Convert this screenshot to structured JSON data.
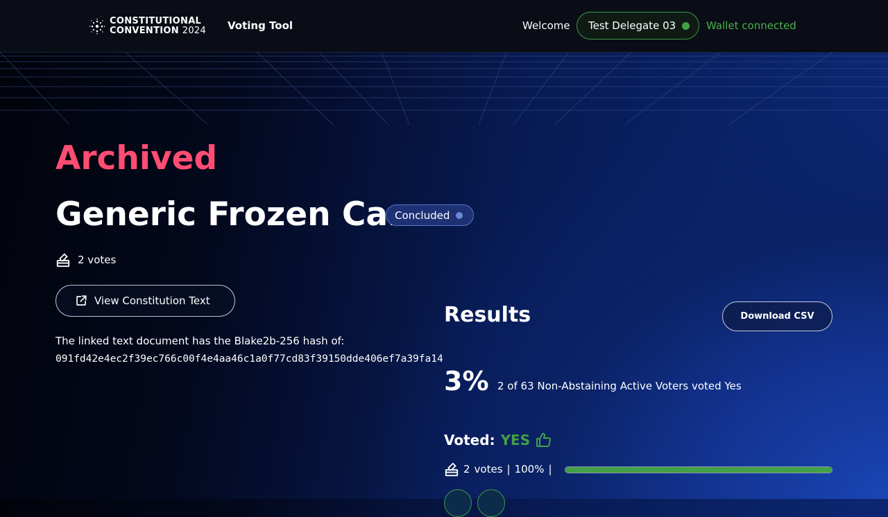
{
  "header": {
    "logo_line1": "CONSTITUTIONAL",
    "logo_line2": "CONVENTION",
    "logo_year": "2024",
    "app_title": "Voting Tool",
    "welcome": "Welcome",
    "user_name": "Test Delegate 03",
    "wallet_status": "Wallet connected"
  },
  "proposal": {
    "section": "Archived",
    "title": "Generic Frozen Car",
    "status": "Concluded",
    "votes_text": "2 votes",
    "constitution_button": "View Constitution Text",
    "hash_label": "The linked text document has the Blake2b-256 hash of:",
    "hash_value": "091fd42e4ec2f39ec766c00f4e4aa46c1a0f77cd83f39150dde406ef7a39fa14"
  },
  "results": {
    "title": "Results",
    "download_button": "Download CSV",
    "percent": "3%",
    "summary": "2 of 63 Non-Abstaining Active Voters voted Yes",
    "voted_label": "Voted:",
    "voted_value": "YES",
    "tally_votes": "2",
    "tally_votes_label": "votes",
    "tally_percent": "100%",
    "yes_fraction": 1.0
  },
  "colors": {
    "archived": "#ff4d72",
    "accent_green": "#43a047",
    "badge_bg": "#1e3175"
  },
  "icons": [
    "logo-icon",
    "ballot-icon",
    "external-link-icon",
    "thumbs-up-icon"
  ]
}
